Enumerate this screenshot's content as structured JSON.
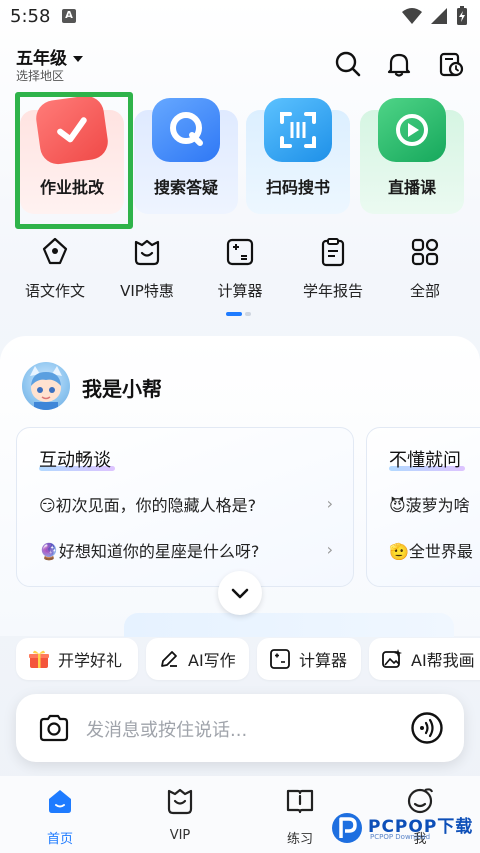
{
  "status": {
    "time": "5:58",
    "badge": "A"
  },
  "header": {
    "grade": "五年级",
    "region": "选择地区"
  },
  "features": [
    {
      "label": "作业批改",
      "color": "#f9524f"
    },
    {
      "label": "搜索答疑",
      "color": "#3c8bff"
    },
    {
      "label": "扫码搜书",
      "color": "#2aa0f0"
    },
    {
      "label": "直播课",
      "color": "#18b36a"
    }
  ],
  "tools": [
    {
      "label": "语文作文",
      "icon": "pen-icon"
    },
    {
      "label": "VIP特惠",
      "icon": "vip-bag-icon"
    },
    {
      "label": "计算器",
      "icon": "calculator-icon"
    },
    {
      "label": "学年报告",
      "icon": "clipboard-icon"
    },
    {
      "label": "全部",
      "icon": "grid-icon"
    }
  ],
  "assistant": {
    "title": "我是小帮"
  },
  "chat_cards": [
    {
      "title": "互动畅谈",
      "lines": [
        "😏初次见面，你的隐藏人格是?",
        "🔮好想知道你的星座是什么呀?"
      ]
    },
    {
      "title": "不懂就问",
      "lines": [
        "😈菠萝为啥",
        "🫡全世界最"
      ]
    }
  ],
  "quick_actions": [
    {
      "label": "开学好礼",
      "icon": "gift-icon"
    },
    {
      "label": "AI写作",
      "icon": "pencil-icon"
    },
    {
      "label": "计算器",
      "icon": "calculator-icon"
    },
    {
      "label": "AI帮我画",
      "icon": "image-ai-icon"
    }
  ],
  "input": {
    "placeholder": "发消息或按住说话..."
  },
  "tabs": [
    {
      "label": "首页",
      "active": true
    },
    {
      "label": "VIP",
      "active": false
    },
    {
      "label": "练习",
      "active": false
    },
    {
      "label": "我",
      "active": false
    }
  ],
  "watermark": {
    "text": "PCPOP下载",
    "sub": "PCPOP Download"
  },
  "colors": {
    "accent": "#1e7bff",
    "highlight": "#2fb34a"
  }
}
